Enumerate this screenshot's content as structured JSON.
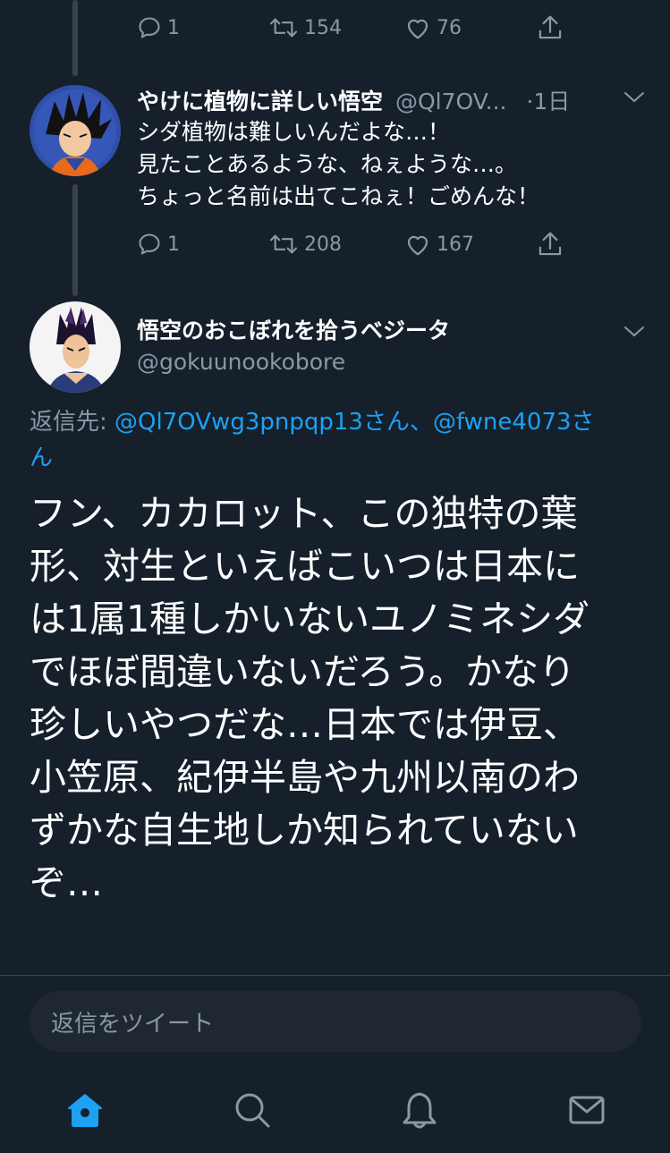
{
  "top_tweet": {
    "reply_count": "1",
    "retweet_count": "154",
    "like_count": "76"
  },
  "goku_tweet": {
    "display_name": "やけに植物に詳しい悟空",
    "handle": "@Ql7OV...",
    "time": "·1日",
    "lines": [
      "シダ植物は難しいんだよな…！",
      "見たことあるような、ねぇような…。",
      "ちょっと名前は出てこねぇ！ごめんな！"
    ],
    "reply_count": "1",
    "retweet_count": "208",
    "like_count": "167"
  },
  "main_tweet": {
    "display_name": "悟空のおこぼれを拾うベジータ",
    "handle": "@gokuunookobore",
    "reply_to_label": "返信先: ",
    "mention_1": "@Ql7OVwg3pnpqp13さん、@fwne4073さ",
    "mention_2": "ん",
    "lines": [
      "フン、カカロット、この独特の葉",
      "形、対生といえばこいつは日本に",
      "は1属1種しかいないユノミネシダ",
      "でほぼ間違いないだろう。かなり",
      "珍しいやつだな…日本では伊豆、",
      "小笠原、紀伊半島や九州以南のわ",
      "ずかな自生地しか知られていない",
      "ぞ…"
    ]
  },
  "reply_box": {
    "placeholder": "返信をツイート"
  },
  "tabbar": {
    "icons": [
      "home-icon",
      "search-icon",
      "notifications-icon",
      "messages-icon"
    ]
  },
  "colors": {
    "background": "#15202b",
    "accent": "#1da1f2",
    "secondary_text": "#8899a6",
    "divider": "#38444d"
  }
}
